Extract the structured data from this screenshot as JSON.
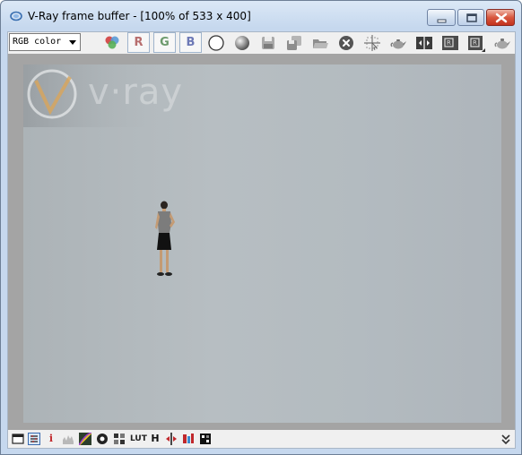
{
  "window": {
    "title": "V-Ray frame buffer - [100% of 533 x 400]",
    "title_icon": "vray-icon",
    "controls": [
      "minimize-icon",
      "maximize-icon",
      "close-icon"
    ]
  },
  "toolbar": {
    "channel_select": {
      "value": "RGB color"
    },
    "channel_buttons": [
      "R",
      "G",
      "B"
    ],
    "icons": [
      "color-dots-icon",
      "white-circle-icon",
      "gray-sphere-icon",
      "save-icon",
      "save-all-icon",
      "open-icon",
      "clear-icon",
      "track-mouse-icon",
      "teapot-icon",
      "compare-icon",
      "region-icon",
      "region-render-icon",
      "render-teapot-icon"
    ]
  },
  "render": {
    "logo_text": "v·ray"
  },
  "statusbar": {
    "icons": [
      "window-icon",
      "color-corrections-icon",
      "info-icon",
      "levels-icon",
      "curve-icon",
      "exposure-icon",
      "lens-effects-icon",
      "lut-icon",
      "history-icon",
      "compare-ab-icon",
      "stamp-icon",
      "grid-icon",
      "expand-icon"
    ],
    "info_label": "i",
    "lut_label": "LUT",
    "history_label": "H"
  },
  "colors": {
    "accent": "#c3321d",
    "render_bg": "#b5bcc0",
    "viewport_bg": "#a4a4a4"
  }
}
